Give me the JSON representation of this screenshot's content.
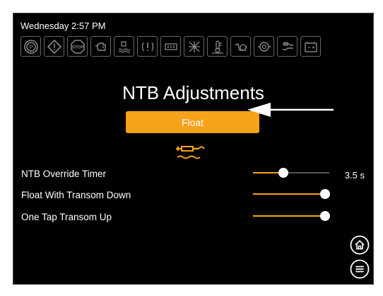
{
  "status": {
    "time": "Wednesday 2:57 PM"
  },
  "indicators": [
    {
      "icon": "parking-brake-icon"
    },
    {
      "icon": "warning-icon"
    },
    {
      "icon": "stop-icon",
      "label": "STOP"
    },
    {
      "icon": "engine-check-icon"
    },
    {
      "icon": "water-in-fuel-icon"
    },
    {
      "icon": "alert-icon-1"
    },
    {
      "icon": "alert-icon-2"
    },
    {
      "icon": "fan-icon"
    },
    {
      "icon": "temperature-icon"
    },
    {
      "icon": "oil-pressure-icon"
    },
    {
      "icon": "pump-icon"
    },
    {
      "icon": "trim-icon"
    },
    {
      "icon": "battery-icon"
    }
  ],
  "page": {
    "title": "NTB Adjustments"
  },
  "mode_button": {
    "label": "Float"
  },
  "settings": [
    {
      "label": "NTB Override Timer",
      "level": 0.4,
      "value": "3.5 s"
    },
    {
      "label": "Float With Transom Down",
      "level": 0.94
    },
    {
      "label": "One Tap Transom Up",
      "level": 0.94
    }
  ],
  "colors": {
    "accent": "#f7a21b",
    "background": "#000000",
    "text": "#ffffff"
  }
}
